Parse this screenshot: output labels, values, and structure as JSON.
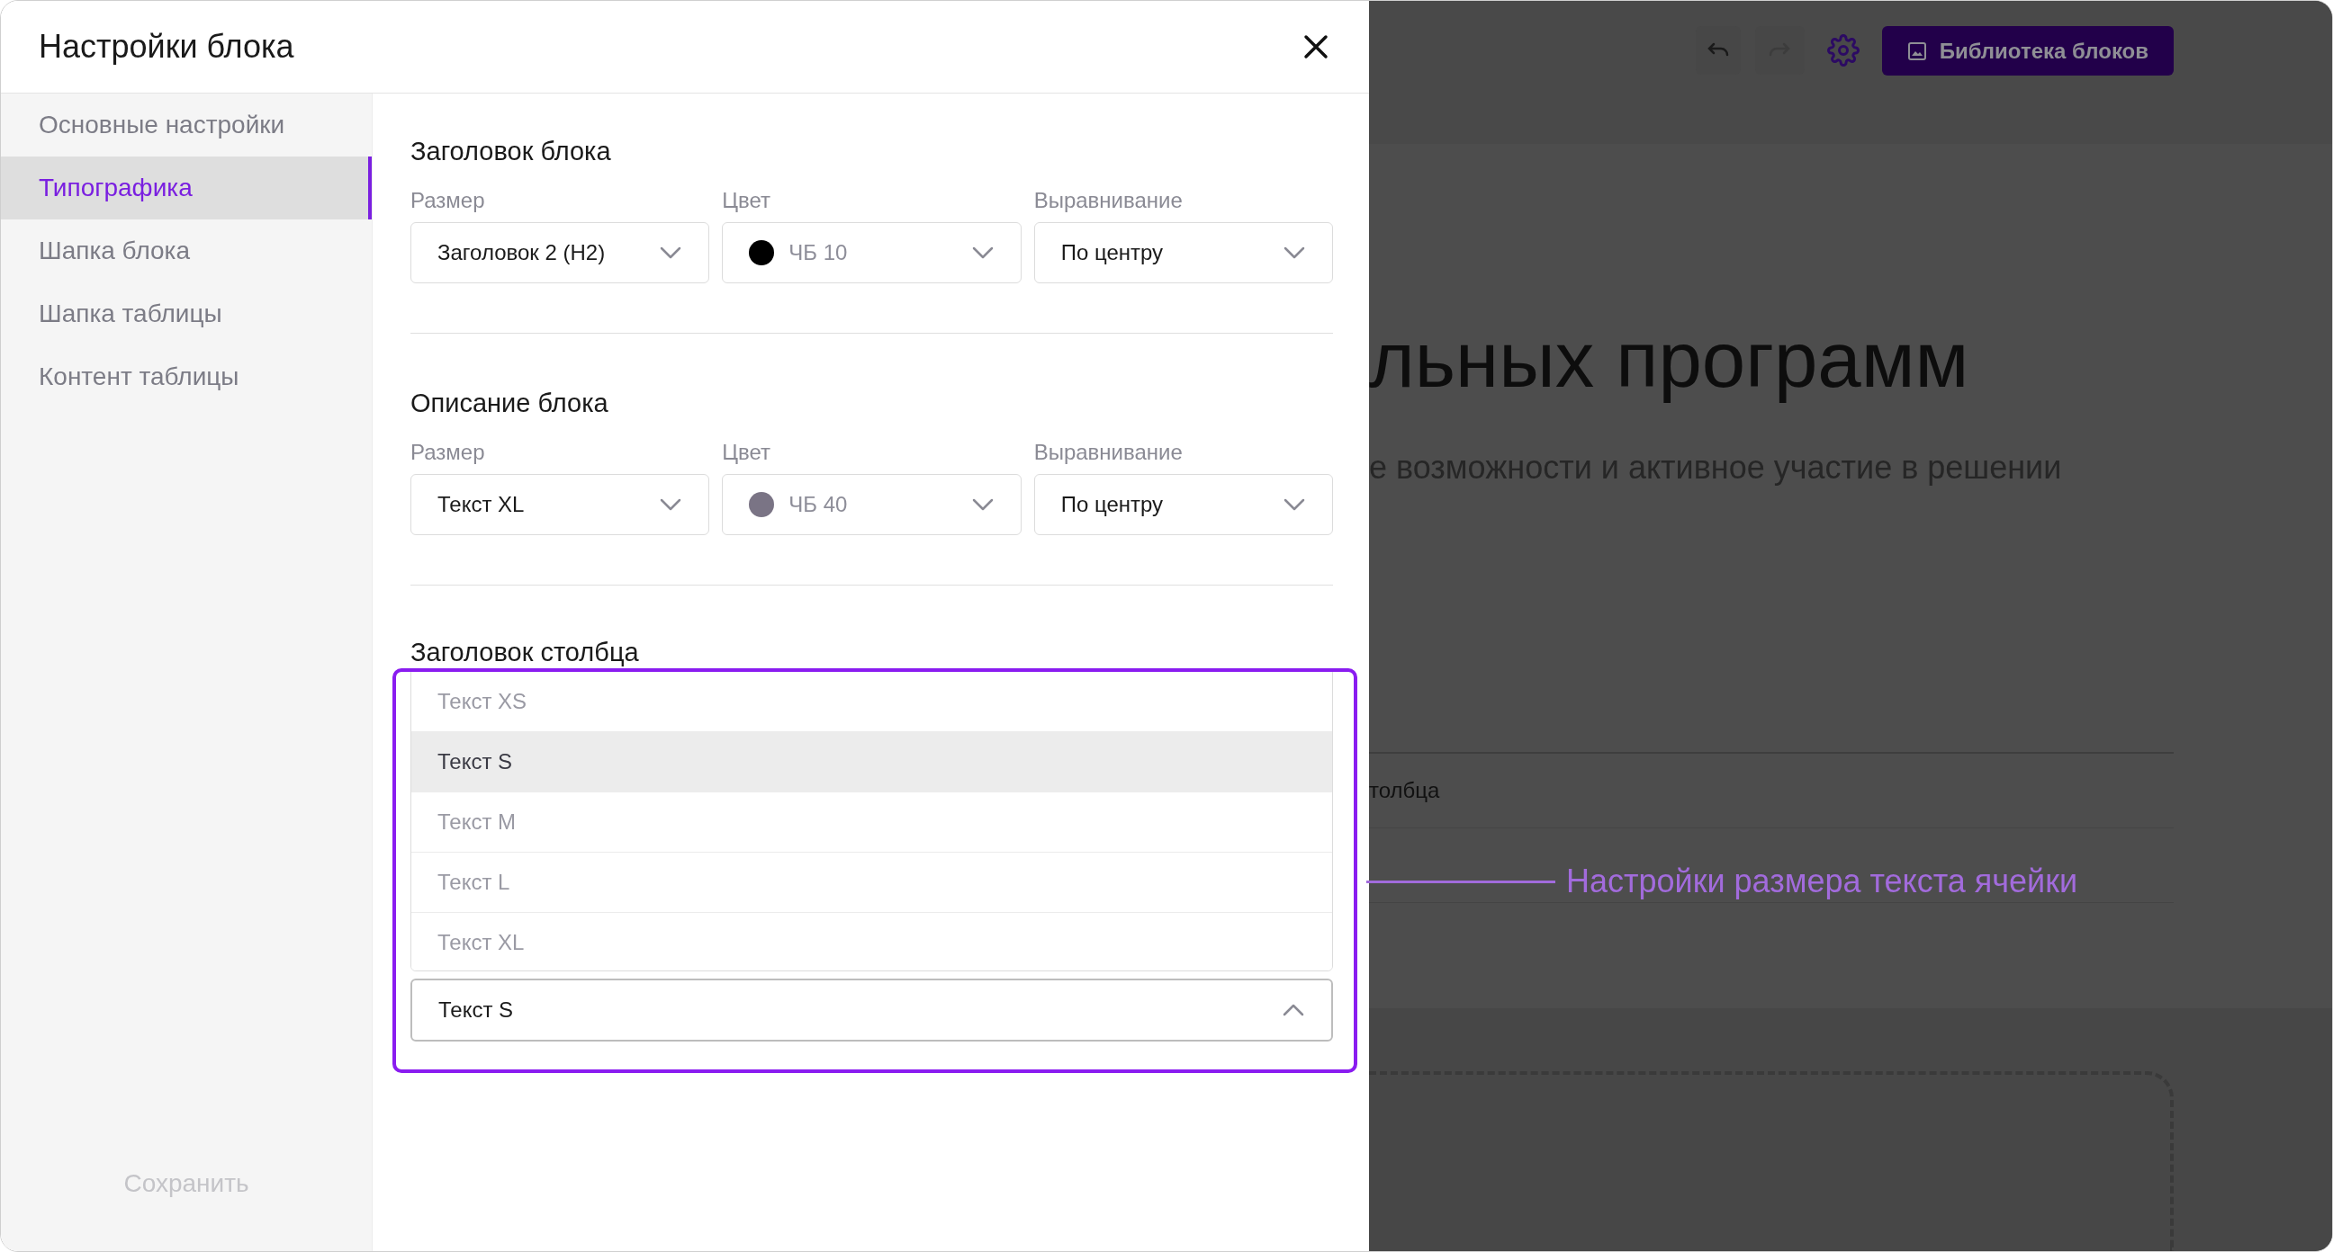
{
  "modal": {
    "title": "Настройки блока",
    "nav": [
      {
        "label": "Основные настройки",
        "selected": false
      },
      {
        "label": "Типографика",
        "selected": true
      },
      {
        "label": "Шапка блока",
        "selected": false
      },
      {
        "label": "Шапка таблицы",
        "selected": false
      },
      {
        "label": "Контент таблицы",
        "selected": false
      }
    ],
    "save_button": {
      "label": "Сохранить",
      "disabled": true
    },
    "sections": [
      {
        "title": "Заголовок блока",
        "fields": [
          {
            "label": "Размер",
            "kind": "select",
            "value": "Заголовок 2 (H2)"
          },
          {
            "label": "Цвет",
            "kind": "color",
            "value": "ЧБ 10",
            "color": "#000000"
          },
          {
            "label": "Выравнивание",
            "kind": "select",
            "value": "По центру"
          }
        ]
      },
      {
        "title": "Описание блока",
        "fields": [
          {
            "label": "Размер",
            "kind": "select",
            "value": "Текст XL"
          },
          {
            "label": "Цвет",
            "kind": "color",
            "value": "ЧБ 40",
            "color": "#7a7485"
          },
          {
            "label": "Выравнивание",
            "kind": "select",
            "value": "По центру"
          }
        ]
      }
    ],
    "column_header": {
      "title": "Заголовок столбца",
      "dropdown": {
        "value": "Текст S",
        "expanded": true,
        "options": [
          {
            "label": "Текст XS",
            "selected": false
          },
          {
            "label": "Текст S",
            "selected": true
          },
          {
            "label": "Текст M",
            "selected": false
          },
          {
            "label": "Текст L",
            "selected": false
          },
          {
            "label": "Текст XL",
            "selected": false
          }
        ]
      }
    }
  },
  "annotation": {
    "text": "Настройки размера текста ячейки"
  },
  "background": {
    "library_button": "Библиотека блоков",
    "heading": "льных программ",
    "description": "е возможности и активное участие в решении",
    "table_cell": "толбца"
  }
}
